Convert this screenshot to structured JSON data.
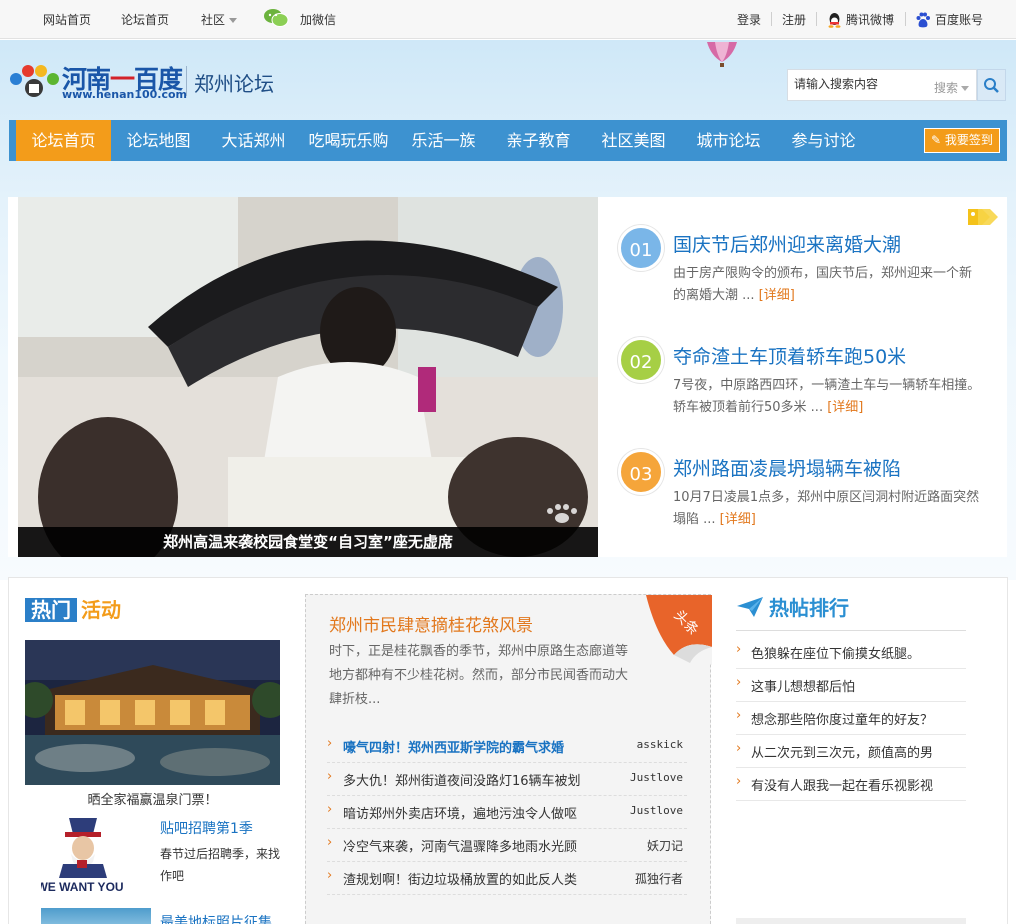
{
  "topbar": {
    "links": [
      "网站首页",
      "论坛首页",
      "社区",
      "加微信"
    ],
    "login": "登录",
    "register": "注册",
    "tencent_weibo": "腾讯微博",
    "baidu_account": "百度账号"
  },
  "header": {
    "logo_part1": "河南",
    "logo_part2": "一",
    "logo_part3": "百度",
    "logo_url": "www.henan100.com",
    "forum_name": "郑州论坛",
    "search_placeholder": "请输入搜索内容",
    "search_type": "搜索"
  },
  "nav": {
    "items": [
      "论坛首页",
      "论坛地图",
      "大话郑州",
      "吃喝玩乐购",
      "乐活一族",
      "亲子教育",
      "社区美图",
      "城市论坛",
      "参与讨论"
    ],
    "active_index": 0,
    "signin": "我要签到"
  },
  "feature": {
    "caption": "郑州高温来袭校园食堂变“自习室”座无虚席",
    "news": [
      {
        "num": "01",
        "title": "国庆节后郑州迎来离婚大潮",
        "desc": "由于房产限购令的颁布，国庆节后，郑州迎来一个新的离婚大潮 ...",
        "more": "[详细]",
        "color": "#7ab6e8"
      },
      {
        "num": "02",
        "title": "夺命渣土车顶着轿车跑50米",
        "desc": "7号夜，中原路西四环，一辆渣土车与一辆轿车相撞。轿车被顶着前行50多米 ...",
        "more": "[详细]",
        "color": "#a6cf45"
      },
      {
        "num": "03",
        "title": "郑州路面凌晨坍塌辆车被陷",
        "desc": "10月7日凌晨1点多，郑州中原区闫洞村附近路面突然塌陷 ...",
        "more": "[详细]",
        "color": "#f5a53a"
      }
    ]
  },
  "activities": {
    "title_part1": "热门",
    "title_part2": "活动",
    "item1_caption": "晒全家福赢温泉门票！",
    "item2_title": "贴吧招聘第1季",
    "item2_desc": "春节过后招聘季，来找作吧",
    "item2_img_text": "WE WANT YOU!",
    "item3_title": "最美地标照片征集"
  },
  "middle": {
    "headline": "郑州市民肆意摘桂花煞风景",
    "desc": "时下，正是桂花飘香的季节，郑州中原路生态廊道等地方都种有不少桂花树。然而，部分市民闻香而动大肆折枝...",
    "corner_tag": "头条",
    "list": [
      {
        "text": "嚎气四射！郑州西亚斯学院的霸气求婚",
        "author": "asskick",
        "highlight": true
      },
      {
        "text": "多大仇！郑州街道夜间没路灯16辆车被划",
        "author": "Justlove",
        "highlight": false
      },
      {
        "text": "暗访郑州外卖店环境，遍地污浊令人做呕",
        "author": "Justlove",
        "highlight": false
      },
      {
        "text": "冷空气来袭，河南气温骤降多地雨水光顾",
        "author": "妖刀记",
        "highlight": false
      },
      {
        "text": "渣规划啊！街边垃圾桶放置的如此反人类",
        "author": "孤独行者",
        "highlight": false
      }
    ]
  },
  "hot_posts": {
    "title": "热帖排行",
    "list": [
      "色狼躲在座位下偷摸女纸腿。",
      "这事儿想想都后怕",
      "想念那些陪你度过童年的好友？",
      "从二次元到三次元，颜值高的男",
      "有没有人跟我一起在看乐视影视"
    ]
  }
}
